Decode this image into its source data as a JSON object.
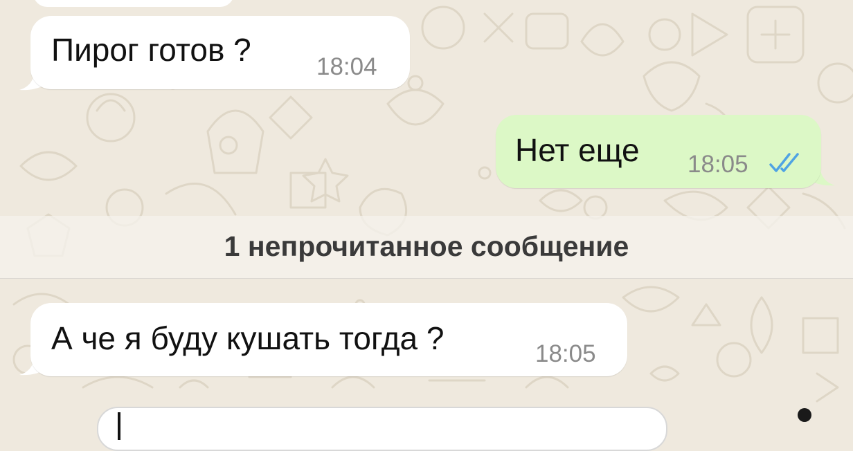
{
  "colors": {
    "incoming_bubble": "#ffffff",
    "outgoing_bubble": "#dcf8c6",
    "read_checkmark": "#4fa3e3",
    "wallpaper": "#efe9de"
  },
  "messages": [
    {
      "direction": "incoming",
      "text": "Пирог готов ?",
      "time": "18:04"
    },
    {
      "direction": "outgoing",
      "text": "Нет еще",
      "time": "18:05",
      "status_icon": "double-check-read-icon"
    },
    {
      "direction": "incoming",
      "text": "А че я буду кушать тогда ?",
      "time": "18:05"
    }
  ],
  "unread_divider": {
    "label": "1 непрочитанное сообщение"
  },
  "composer": {
    "value": ""
  }
}
